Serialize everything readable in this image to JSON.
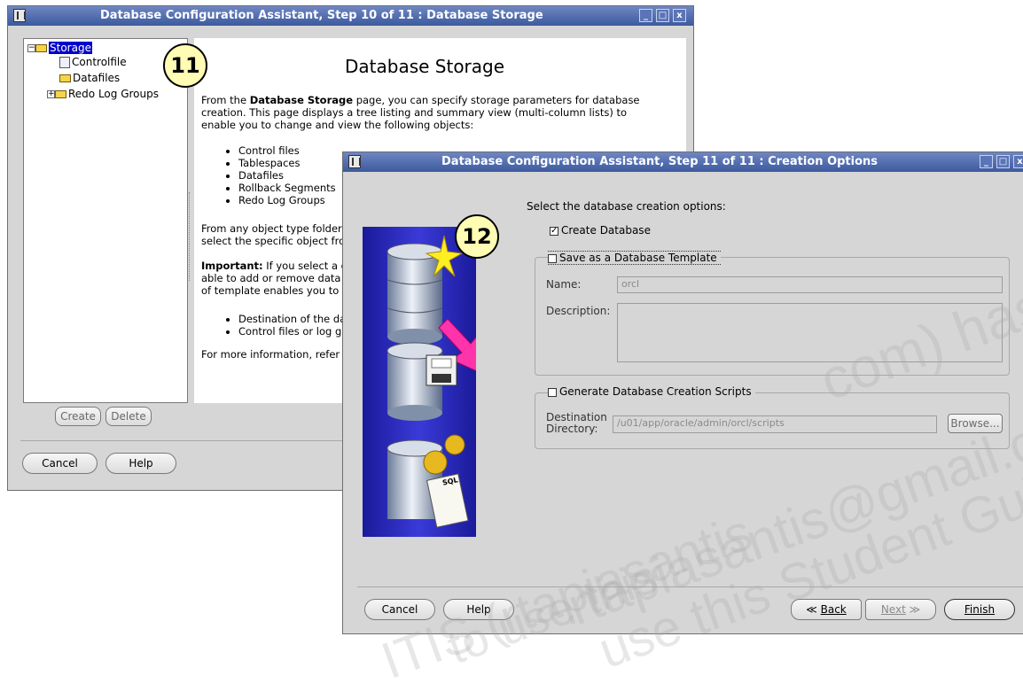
{
  "window1": {
    "title": "Database Configuration Assistant, Step 10 of 11 : Database Storage",
    "tree": {
      "root": "Storage",
      "items": [
        "Controlfile",
        "Datafiles",
        "Redo Log Groups"
      ]
    },
    "callout": "11",
    "help": {
      "heading": "Database Storage",
      "intro_pre": "From the ",
      "intro_bold": "Database Storage",
      "intro_post": " page, you can specify storage parameters for database creation. This page displays a tree listing and summary view (multi-column lists) to enable you to change and view the following objects:",
      "objects": [
        "Control files",
        "Tablespaces",
        "Datafiles",
        "Rollback Segments",
        "Redo Log Groups"
      ],
      "para2": "From any object type folder select the specific object fro",
      "important_label": "Important:",
      "important_text": " If you select a d able to add or remove data of template enables you to",
      "bullets2": [
        "Destination of the da",
        "Control files or log gr"
      ],
      "para3": "For more information, refer"
    },
    "buttons": {
      "create": "Create",
      "delete": "Delete",
      "cancel": "Cancel",
      "help": "Help"
    }
  },
  "window2": {
    "title": "Database Configuration Assistant, Step 11 of 11 : Creation Options",
    "callout": "12",
    "prompt": "Select the database creation options:",
    "create_db": {
      "label": "Create Database",
      "checked": true
    },
    "save_template": {
      "label": "Save as a Database Template",
      "checked": false,
      "name_label": "Name:",
      "name_value": "orcl",
      "desc_label": "Description:"
    },
    "gen_scripts": {
      "label": "Generate Database Creation Scripts",
      "checked": false,
      "dest_label_1": "Destination",
      "dest_label_2": "Directory:",
      "dest_value": "/u01/app/oracle/admin/orcl/scripts",
      "browse": "Browse..."
    },
    "illustration_sql": "SQL",
    "buttons": {
      "cancel": "Cancel",
      "help": "Help",
      "back": "Back",
      "next": "Next",
      "finish": "Finish"
    }
  },
  "watermark": {
    "line1": "com) has",
    "line2": "rtapiasantis@gmail.com) has",
    "line3": "use this Student Guide.",
    "line4": "ITIS (rtapiasantis",
    "line5": "to use this"
  },
  "colors": {
    "titlebar": "#4a66ac",
    "selection": "#0000cc",
    "callout": "#fffcb4"
  }
}
